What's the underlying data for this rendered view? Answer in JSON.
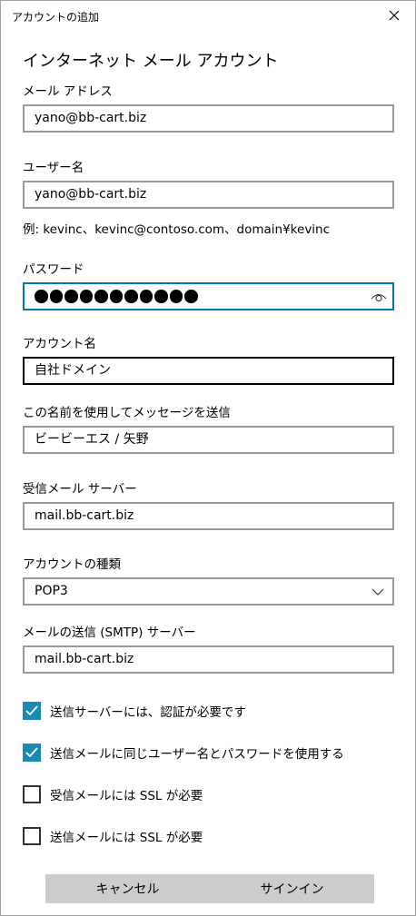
{
  "window": {
    "title": "アカウントの追加"
  },
  "heading": "インターネット メール アカウント",
  "email": {
    "label": "メール アドレス",
    "value": "yano@bb-cart.biz"
  },
  "username": {
    "label": "ユーザー名",
    "value": "yano@bb-cart.biz",
    "hint": "例: kevinc、kevinc@contoso.com、domain¥kevinc"
  },
  "password": {
    "label": "パスワード",
    "masked_length": 11
  },
  "account_name": {
    "label": "アカウント名",
    "value": "自社ドメイン"
  },
  "sender_name": {
    "label": "この名前を使用してメッセージを送信",
    "value": "ビービーエス / 矢野"
  },
  "incoming_server": {
    "label": "受信メール サーバー",
    "value": "mail.bb-cart.biz"
  },
  "account_type": {
    "label": "アカウントの種類",
    "selected": "POP3"
  },
  "outgoing_server": {
    "label": "メールの送信 (SMTP) サーバー",
    "value": "mail.bb-cart.biz"
  },
  "options": [
    {
      "label": "送信サーバーには、認証が必要です",
      "checked": true
    },
    {
      "label": "送信メールに同じユーザー名とパスワードを使用する",
      "checked": true
    },
    {
      "label": "受信メールには SSL が必要",
      "checked": false
    },
    {
      "label": "送信メールには SSL が必要",
      "checked": false
    }
  ],
  "buttons": {
    "cancel": "キャンセル",
    "signin": "サインイン"
  },
  "colors": {
    "accent": "#1a8ab0",
    "focus_border": "#0078a8",
    "button_bg": "#cccccc"
  }
}
